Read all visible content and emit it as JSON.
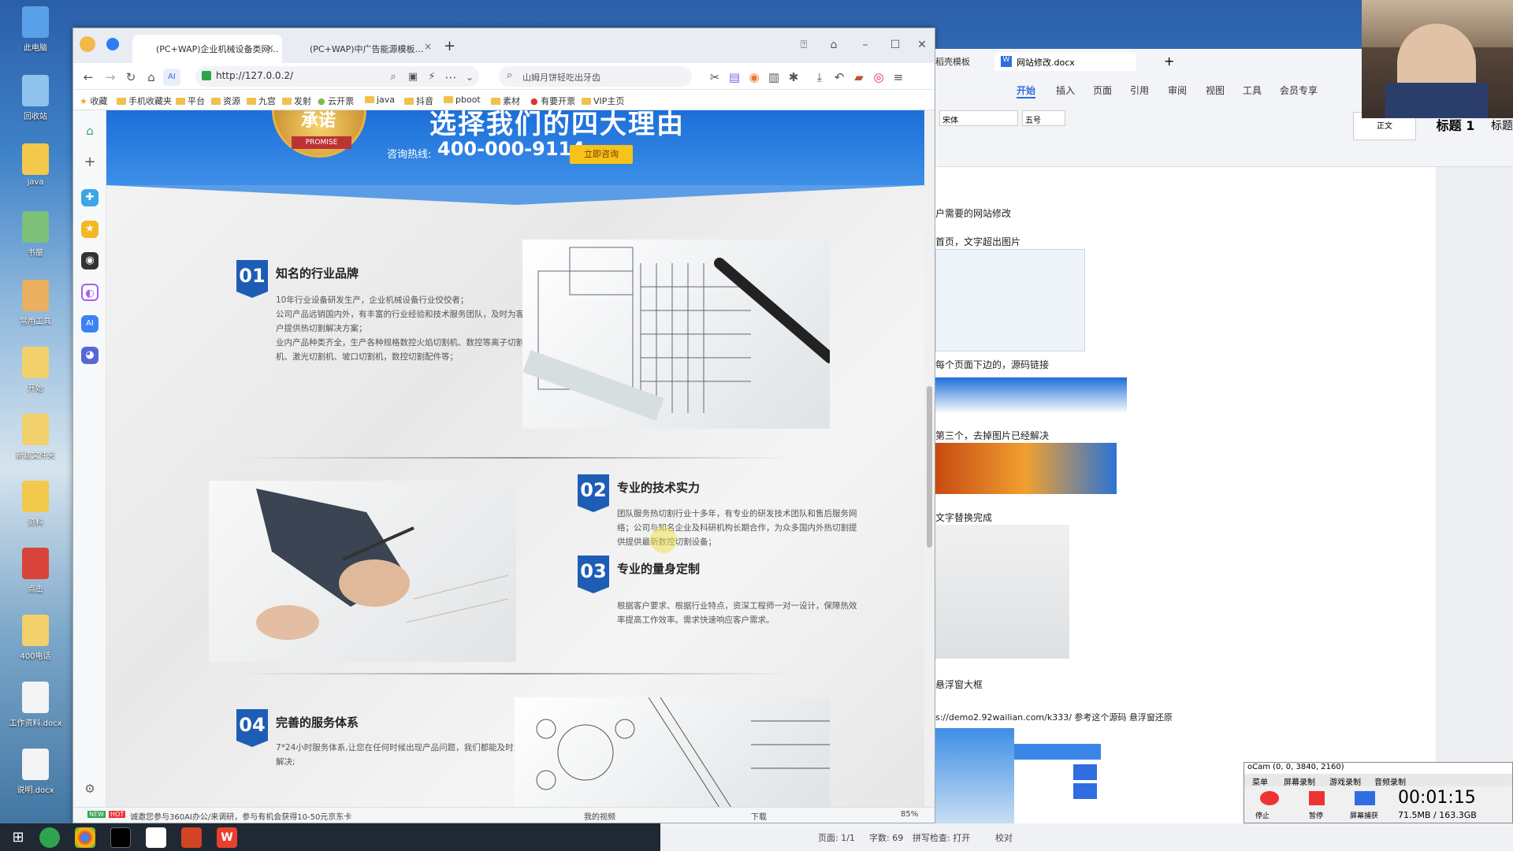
{
  "desktop": {
    "icons": [
      "此电脑",
      "回收站",
      "java",
      "书屋",
      "常用工具",
      "开始",
      "新建文件夹",
      "资料",
      "点击",
      "400电话",
      "工作资料.docx",
      "说明.docx"
    ]
  },
  "browser": {
    "tabs": [
      "(PC+WAP)企业机械设备类网…",
      "(PC+WAP)中广告能源模板…"
    ],
    "url": "http://127.0.0.2/",
    "search_placeholder": "山姆月饼轻吃出牙齿",
    "bookmarks": [
      "收藏",
      "手机收藏夹",
      "平台",
      "资源",
      "九宫",
      "发射",
      "云开票",
      "java",
      "抖音",
      "pboot",
      "素材",
      "有要开票",
      "VIP主页"
    ],
    "status_text": "诚邀您参与360AI办公/来调研，参与有机会获得10-50元京东卡",
    "zoom": "85%",
    "status_items": [
      "我的视频",
      "下载"
    ]
  },
  "page": {
    "hotline_label": "咨询热线:",
    "hotline": "400-000-9114",
    "cta": "立即咨询",
    "promise": "PROMISE",
    "badge": "承诺",
    "heading": "选择我们的四大理由",
    "sections": [
      {
        "num": "01",
        "title": "知名的行业品牌",
        "text": [
          "10年行业设备研发生产，企业机械设备行业佼佼者；",
          "公司产品远销国内外，有丰富的行业经验和技术服务团队，及时为客",
          "户提供热切割解决方案；",
          "业内产品种类齐全，生产各种规格数控火焰切割机、数控等离子切割",
          "机、激光切割机、坡口切割机，数控切割配件等；"
        ]
      },
      {
        "num": "02",
        "title": "专业的技术实力",
        "text": [
          "团队服务热切割行业十多年，有专业的研发技术团队和售后服务网",
          "络；公司与知名企业及科研机构长期合作，为众多国内外热切割提",
          "供提供最新数控切割设备；"
        ]
      },
      {
        "num": "03",
        "title": "专业的量身定制",
        "text": [
          "根据客户要求、根据行业特点，资深工程师一对一设计，保障热效",
          "率提高工作效率。需求快速响应客户需求。"
        ]
      },
      {
        "num": "04",
        "title": "完善的服务体系",
        "text": [
          "7*24小时服务体系,让您在任何时候出现产品问题，我们都能及时为您",
          "解决;"
        ]
      }
    ]
  },
  "wps": {
    "tab_home": "稻壳模板",
    "doc_tab": "网站修改.docx",
    "ribbon": [
      "开始",
      "插入",
      "页面",
      "引用",
      "审阅",
      "视图",
      "工具",
      "会员专享"
    ],
    "font": "宋体",
    "size": "五号",
    "style_normal": "正文",
    "style_h1": "标题 1",
    "style_h2": "标题",
    "lines": [
      "户需要的网站修改",
      "首页，文字超出图片",
      "每个页面下边的，源码链接",
      "第三个，去掉图片已经解决",
      "文字替换完成",
      "悬浮窗大框",
      "s://demo2.92wailian.com/k333/  参考这个源码  悬浮窗还原"
    ],
    "status": {
      "page": "页面: 1/1",
      "words": "字数: 69",
      "spell": "拼写检查: 打开",
      "proof": "校对"
    }
  },
  "oCam": {
    "title": "oCam (0, 0, 3840, 2160)",
    "menus": [
      "菜单",
      "屏幕录制",
      "游戏录制",
      "音频录制"
    ],
    "buttons": [
      "停止",
      "暂停",
      "屏幕捕获"
    ],
    "time": "00:01:15",
    "size": "71.5MB / 163.3GB"
  }
}
